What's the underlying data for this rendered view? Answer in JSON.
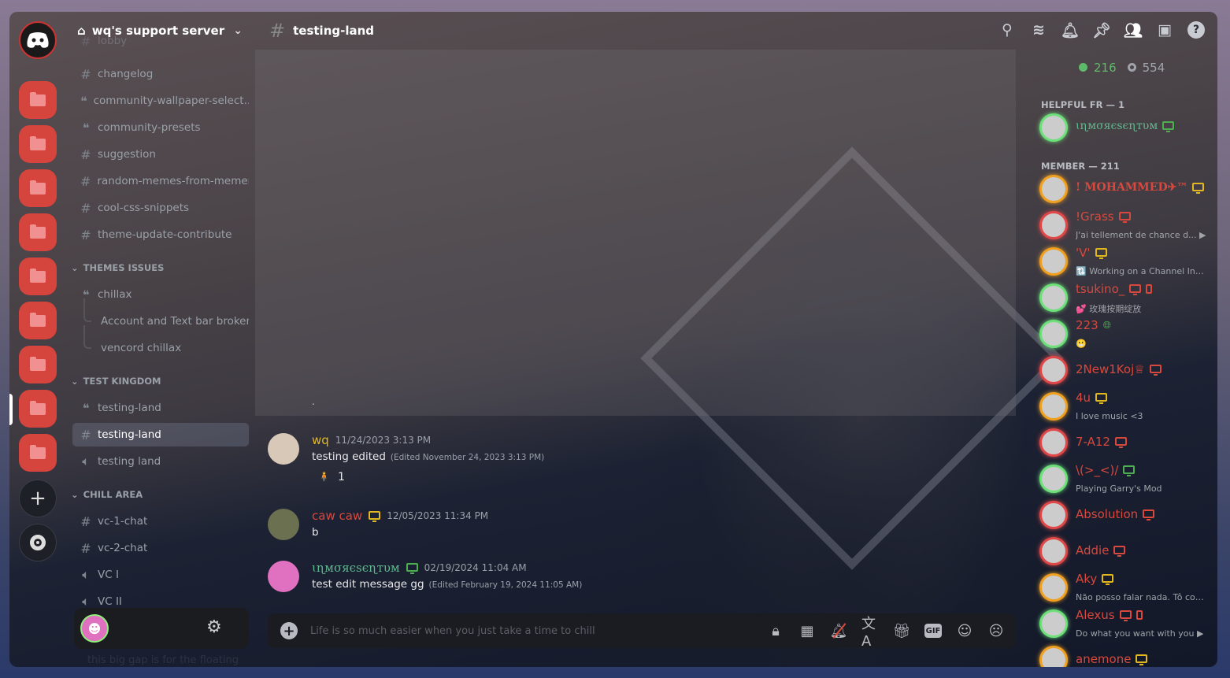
{
  "server": {
    "name": "wq's support server"
  },
  "channel": {
    "name": "testing-land"
  },
  "rail": {
    "folder_count": 9
  },
  "sidebar": {
    "partial_top": "lobby",
    "items": [
      {
        "type": "text",
        "label": "changelog"
      },
      {
        "type": "forum",
        "label": "community-wallpaper-select..."
      },
      {
        "type": "forum",
        "label": "community-presets"
      },
      {
        "type": "text",
        "label": "suggestion"
      },
      {
        "type": "text",
        "label": "random-memes-from-memers"
      },
      {
        "type": "text",
        "label": "cool-css-snippets"
      },
      {
        "type": "text",
        "label": "theme-update-contribute"
      },
      {
        "type": "category",
        "label": "THEMES ISSUES"
      },
      {
        "type": "forum",
        "label": "chillax"
      },
      {
        "type": "thread",
        "label": "Account and Text bar broken"
      },
      {
        "type": "thread",
        "label": "vencord chillax"
      },
      {
        "type": "category",
        "label": "TEST KINGDOM"
      },
      {
        "type": "forum",
        "label": "testing-land"
      },
      {
        "type": "text",
        "label": "testing-land",
        "selected": true
      },
      {
        "type": "voice",
        "label": "testing land"
      },
      {
        "type": "category",
        "label": "CHILL AREA"
      },
      {
        "type": "text",
        "label": "vc-1-chat"
      },
      {
        "type": "text",
        "label": "vc-2-chat"
      },
      {
        "type": "voice",
        "label": "VC I"
      },
      {
        "type": "voice",
        "label": "VC II"
      }
    ],
    "gap_note": "this big gap is for the floating user controls, so say if it looks ugly"
  },
  "header_icons": [
    "threads-icon",
    "notification-bell-icon",
    "pin-icon",
    "member-list-icon",
    "inbox-icon",
    "help-icon"
  ],
  "messages": [
    {
      "author": "wq",
      "color": "#e3b81f",
      "timestamp": "11/24/2023 3:13 PM",
      "text": "testing edited",
      "edited": "(Edited November 24, 2023 3:13 PM)",
      "reaction": {
        "emoji": "🧍",
        "count": "1"
      }
    },
    {
      "author": "caw caw",
      "color": "#d9483c",
      "device": "#e3b81f",
      "timestamp": "12/05/2023 11:34 PM",
      "text": "b"
    },
    {
      "author": "ɩɳмσяєѕєɳтυм",
      "color": "#5fb98e",
      "device": "#4caf50",
      "timestamp": "02/19/2024 11:04 AM",
      "text": "test edit message gg",
      "edited": "(Edited February 19, 2024 11:05 AM)"
    }
  ],
  "stray_text": ".",
  "composer": {
    "placeholder": "Life is so much easier when you just take a time to chill"
  },
  "members": {
    "online": "216",
    "offline": "554",
    "groups": [
      {
        "label": "HELPFUL FR — 1",
        "members": [
          {
            "name": "ɩɳмσяєѕєɳтυм",
            "color": "#5fb98e",
            "ring": "#6ee07a",
            "devices": [
              "desktop"
            ],
            "dev_color": "#4caf50"
          }
        ]
      },
      {
        "label": "MEMBER — 211",
        "members": [
          {
            "name": "! MOHAMMED✈™",
            "color": "#d9483c",
            "ring": "#f0a020",
            "devices": [
              "desktop"
            ],
            "dev_color": "#e3b81f",
            "serif": true
          },
          {
            "name": "!Grass",
            "color": "#d9483c",
            "ring": "#e04848",
            "devices": [
              "desktop"
            ],
            "dev_color": "#d9483c",
            "status": "J'ai tellement de chance d... ▶"
          },
          {
            "name": "'V'",
            "color": "#d9483c",
            "ring": "#f0a020",
            "devices": [
              "desktop"
            ],
            "dev_color": "#e3b81f",
            "status": "🔃 Working on a Channel Intr..."
          },
          {
            "name": "tsukino_",
            "color": "#d9483c",
            "ring": "#6ee07a",
            "devices": [
              "desktop",
              "mobile"
            ],
            "dev_color": "#d9483c",
            "status": "💕 玫瑰按期绽放"
          },
          {
            "name": "223",
            "color": "#d9483c",
            "ring": "#6ee07a",
            "devices": [
              "globe"
            ],
            "dev_color": "#4caf50",
            "status": "😬"
          },
          {
            "name": "2New1Koj♕",
            "color": "#d9483c",
            "ring": "#e04848",
            "devices": [
              "desktop"
            ],
            "dev_color": "#d9483c"
          },
          {
            "name": "4u",
            "color": "#d9483c",
            "ring": "#f0a020",
            "devices": [
              "desktop"
            ],
            "dev_color": "#e3b81f",
            "status": "I love music <3"
          },
          {
            "name": "7-A12",
            "color": "#d9483c",
            "ring": "#e04848",
            "devices": [
              "desktop"
            ],
            "dev_color": "#d9483c"
          },
          {
            "name": "\\(>_<)/",
            "color": "#d9483c",
            "ring": "#6ee07a",
            "devices": [
              "desktop"
            ],
            "dev_color": "#4caf50",
            "status": "Playing Garry's Mod"
          },
          {
            "name": "Absolution",
            "color": "#d9483c",
            "ring": "#e04848",
            "devices": [
              "desktop"
            ],
            "dev_color": "#d9483c"
          },
          {
            "name": "Addie",
            "color": "#d9483c",
            "ring": "#e04848",
            "devices": [
              "desktop"
            ],
            "dev_color": "#d9483c"
          },
          {
            "name": "Aky",
            "color": "#d9483c",
            "ring": "#f0a020",
            "devices": [
              "desktop"
            ],
            "dev_color": "#e3b81f",
            "status": "Não posso falar nada. Tô com ..."
          },
          {
            "name": "Alexus",
            "color": "#d9483c",
            "ring": "#6ee07a",
            "devices": [
              "desktop",
              "mobile"
            ],
            "dev_color": "#d9483c",
            "status": "Do what you want with you ▶"
          },
          {
            "name": "anemone",
            "color": "#d9483c",
            "ring": "#f0a020",
            "devices": [
              "desktop"
            ],
            "dev_color": "#e3b81f"
          }
        ]
      }
    ]
  }
}
